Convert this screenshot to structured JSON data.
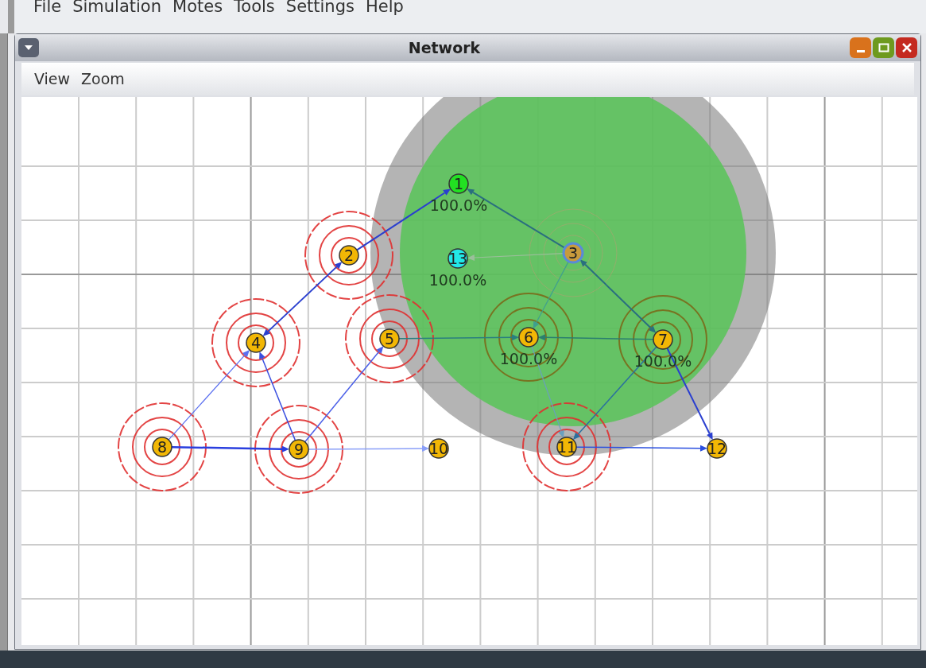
{
  "app_menu": [
    "File",
    "Simulation",
    "Motes",
    "Tools",
    "Settings",
    "Help"
  ],
  "window": {
    "title": "Network",
    "menu": [
      "View",
      "Zoom"
    ]
  },
  "nodes": [
    {
      "label": "1",
      "color": "#22e022",
      "kind": "plain",
      "selected": false,
      "percent": "100.0%"
    },
    {
      "label": "2",
      "color": "#f2b705",
      "kind": "interfering",
      "selected": false
    },
    {
      "label": "3",
      "color": "#c89a3c",
      "kind": "faint",
      "selected": true
    },
    {
      "label": "13",
      "color": "#22e8e8",
      "kind": "plain",
      "selected": false,
      "percent": "100.0%"
    },
    {
      "label": "4",
      "color": "#f2b705",
      "kind": "interfering",
      "selected": false
    },
    {
      "label": "5",
      "color": "#f2b705",
      "kind": "interfering",
      "selected": false
    },
    {
      "label": "6",
      "color": "#f2b705",
      "kind": "receiving",
      "selected": false,
      "percent": "100.0%"
    },
    {
      "label": "7",
      "color": "#f2b705",
      "kind": "receiving",
      "selected": false,
      "percent": "100.0%"
    },
    {
      "label": "8",
      "color": "#f2b705",
      "kind": "interfering",
      "selected": false
    },
    {
      "label": "9",
      "color": "#f2b705",
      "kind": "interfering",
      "selected": false
    },
    {
      "label": "10",
      "color": "#f2b705",
      "kind": "plain",
      "selected": false
    },
    {
      "label": "11",
      "color": "#f2b705",
      "kind": "interfering",
      "selected": false
    },
    {
      "label": "12",
      "color": "#f2b705",
      "kind": "plain",
      "selected": false
    }
  ]
}
